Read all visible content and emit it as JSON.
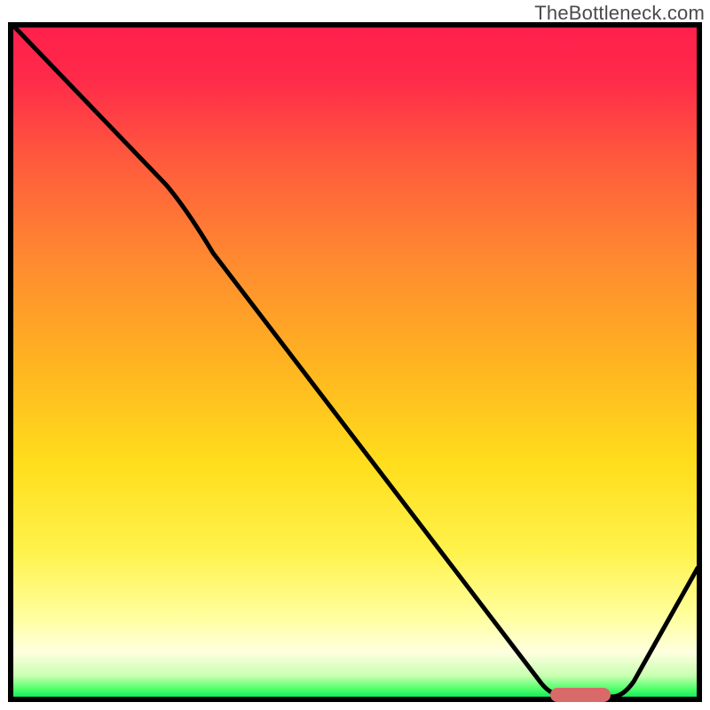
{
  "watermark": "TheBottleneck.com",
  "chart_data": {
    "type": "line",
    "title": "",
    "xlabel": "",
    "ylabel": "",
    "xlim": [
      0,
      1
    ],
    "ylim": [
      0,
      1
    ],
    "grid": false,
    "background_gradient": {
      "direction": "vertical",
      "stops": [
        {
          "pos": 0.0,
          "color": "#ff1f4b"
        },
        {
          "pos": 0.35,
          "color": "#ff8a30"
        },
        {
          "pos": 0.65,
          "color": "#ffde1c"
        },
        {
          "pos": 0.93,
          "color": "#ffffe0"
        },
        {
          "pos": 1.0,
          "color": "#00e65a"
        }
      ]
    },
    "series": [
      {
        "name": "bottleneck-curve",
        "color": "#000000",
        "x": [
          0.0,
          0.22,
          0.28,
          0.78,
          0.81,
          0.87,
          0.9,
          1.0
        ],
        "y": [
          1.0,
          0.77,
          0.67,
          0.02,
          0.0,
          0.0,
          0.02,
          0.2
        ]
      }
    ],
    "annotations": [
      {
        "name": "optimal-marker",
        "shape": "pill",
        "color": "#d96a6a",
        "x_range": [
          0.79,
          0.88
        ],
        "y": 0.0
      }
    ]
  }
}
